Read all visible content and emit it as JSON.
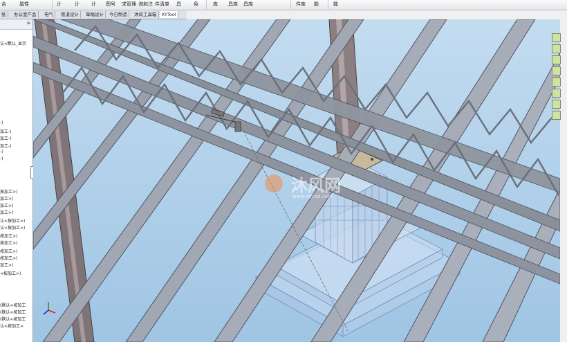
{
  "toolbar": {
    "items": [
      "合",
      "属性",
      "计",
      "计",
      "计",
      "图号",
      "求管理",
      "询和注",
      "件清单",
      "具",
      "色",
      "库",
      "具库",
      "具库",
      "件库",
      "能",
      "能"
    ]
  },
  "tabs": [
    "纸",
    "办公室产品",
    "电气",
    "管道设计",
    "草稿设计",
    "今日制造",
    "沐风工具箱",
    "KYTool"
  ],
  "active_tab_index": 7,
  "panel": {
    "collapse_label": "»",
    "tree": [
      "认<默认_显示",
      "-)",
      "加工-)",
      "加工-)",
      "加工-)",
      "-)",
      "-)",
      "按加工>)",
      "加工>)",
      "加工>)",
      "加工>)",
      "认<按加工>)",
      "认<按加工>)",
      "按加工>)",
      "按加工>)",
      "按加工>)",
      "按加工>)",
      "加工>)",
      "<按加工>)",
      "(默认<按加工",
      "(默认<按加工",
      "(默认<按加工",
      "认<按加工>"
    ]
  },
  "watermark": {
    "text": "沐风网",
    "url": "www.mfcad.com"
  },
  "colors": {
    "viewport_top": "#b9d5ec",
    "beam": "#5a6170",
    "column": "#8a7d7f",
    "accent": "#f08a4b"
  }
}
